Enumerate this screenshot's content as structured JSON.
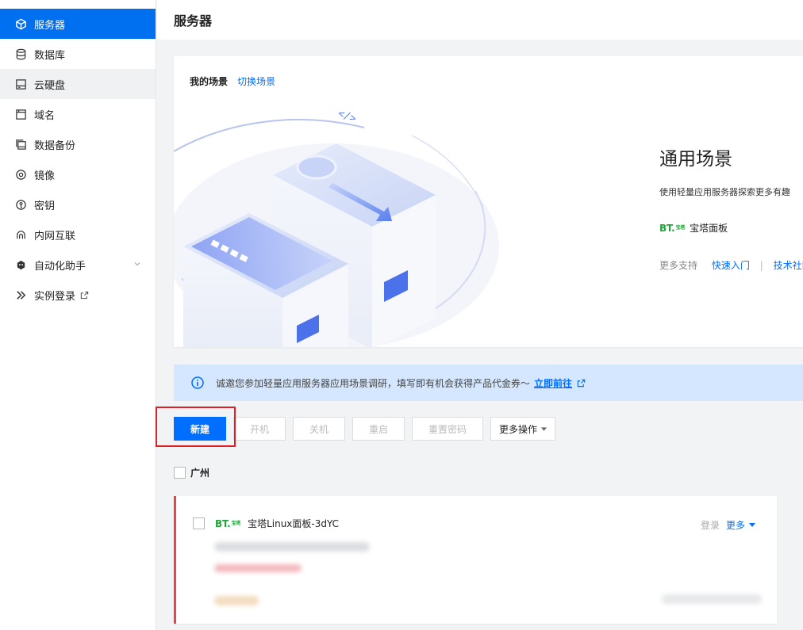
{
  "sidebar": {
    "items": [
      {
        "label": "服务器",
        "icon": "box-icon"
      },
      {
        "label": "数据库",
        "icon": "database-icon"
      },
      {
        "label": "云硬盘",
        "icon": "disk-icon"
      },
      {
        "label": "域名",
        "icon": "window-icon"
      },
      {
        "label": "数据备份",
        "icon": "backup-icon"
      },
      {
        "label": "镜像",
        "icon": "disc-icon"
      },
      {
        "label": "密钥",
        "icon": "key-icon"
      },
      {
        "label": "内网互联",
        "icon": "link-icon"
      },
      {
        "label": "自动化助手",
        "icon": "robot-icon"
      },
      {
        "label": "实例登录",
        "icon": "terminal-icon"
      }
    ]
  },
  "header": {
    "title": "服务器"
  },
  "scene": {
    "title": "我的场景",
    "switch_label": "切换场景",
    "heading": "通用场景",
    "description": "使用轻量应用服务器探索更多有趣",
    "bt_logo": "BT.",
    "bt_logo_small": "宝塔",
    "bt_name": "宝塔面板",
    "support_label": "更多支持",
    "quick_start": "快速入门",
    "separator": "|",
    "community": "技术社区"
  },
  "infobar": {
    "text": "诚邀您参加轻量应用服务器应用场景调研，填写即有机会获得产品代金券～",
    "link": "立即前往"
  },
  "toolbar": {
    "new": "新建",
    "start": "开机",
    "stop": "关机",
    "restart": "重启",
    "reset_password": "重置密码",
    "more_ops": "更多操作"
  },
  "region": {
    "label": "广州"
  },
  "instance": {
    "bt_logo": "BT.",
    "name": "宝塔Linux面板-3dYC",
    "login": "登录",
    "more": "更多"
  },
  "colors": {
    "accent": "#006eff",
    "active_nav": "#0070f0",
    "bt_green": "#20a53a",
    "danger": "#e54545"
  }
}
